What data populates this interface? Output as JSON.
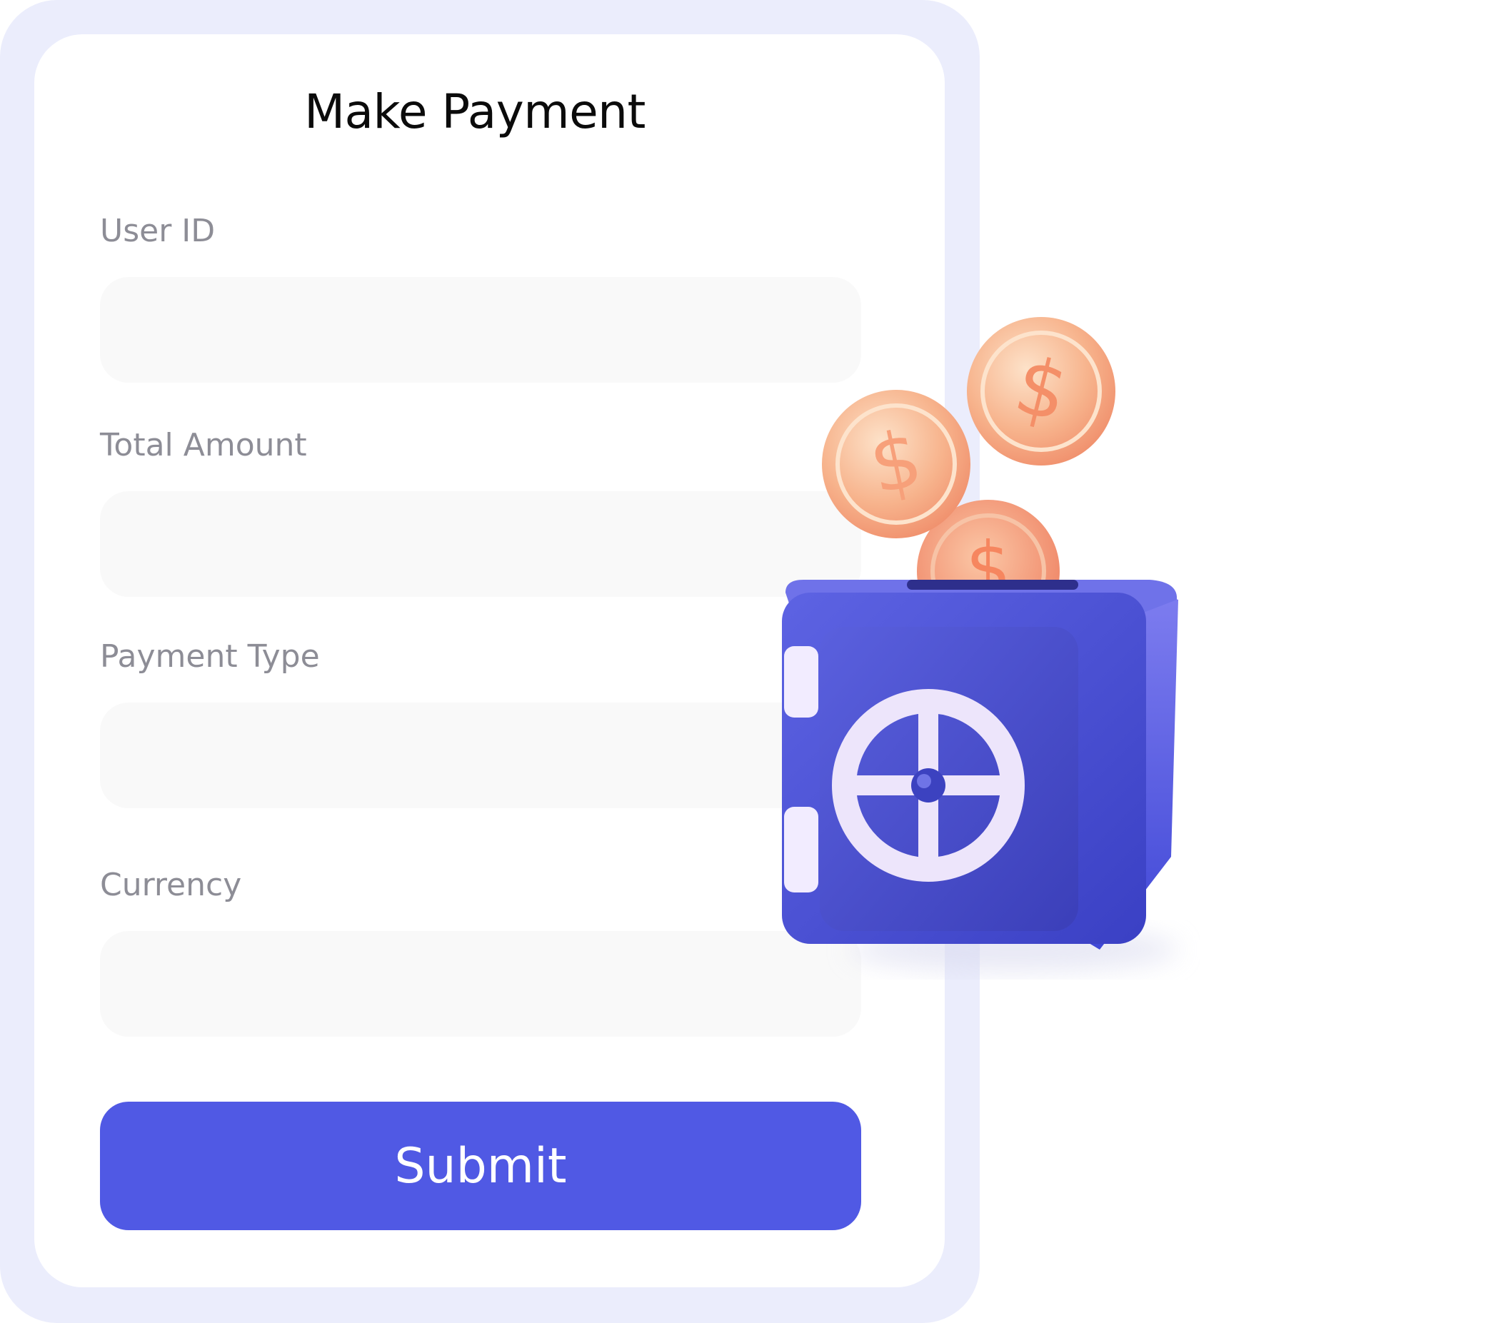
{
  "form": {
    "title": "Make Payment",
    "fields": [
      {
        "label": "User ID",
        "value": "",
        "placeholder": ""
      },
      {
        "label": "Total Amount",
        "value": "",
        "placeholder": ""
      },
      {
        "label": "Payment Type",
        "value": "",
        "placeholder": ""
      },
      {
        "label": "Currency",
        "value": "",
        "placeholder": ""
      }
    ],
    "submit_label": "Submit"
  },
  "illustration": {
    "icon": "safe-with-coins-icon",
    "coin_symbol": "$",
    "colors": {
      "safe_body": "#4a4fd0",
      "safe_dial": "#ece4fb",
      "coin": "#f6b48e",
      "accent": "#5059e4"
    }
  }
}
